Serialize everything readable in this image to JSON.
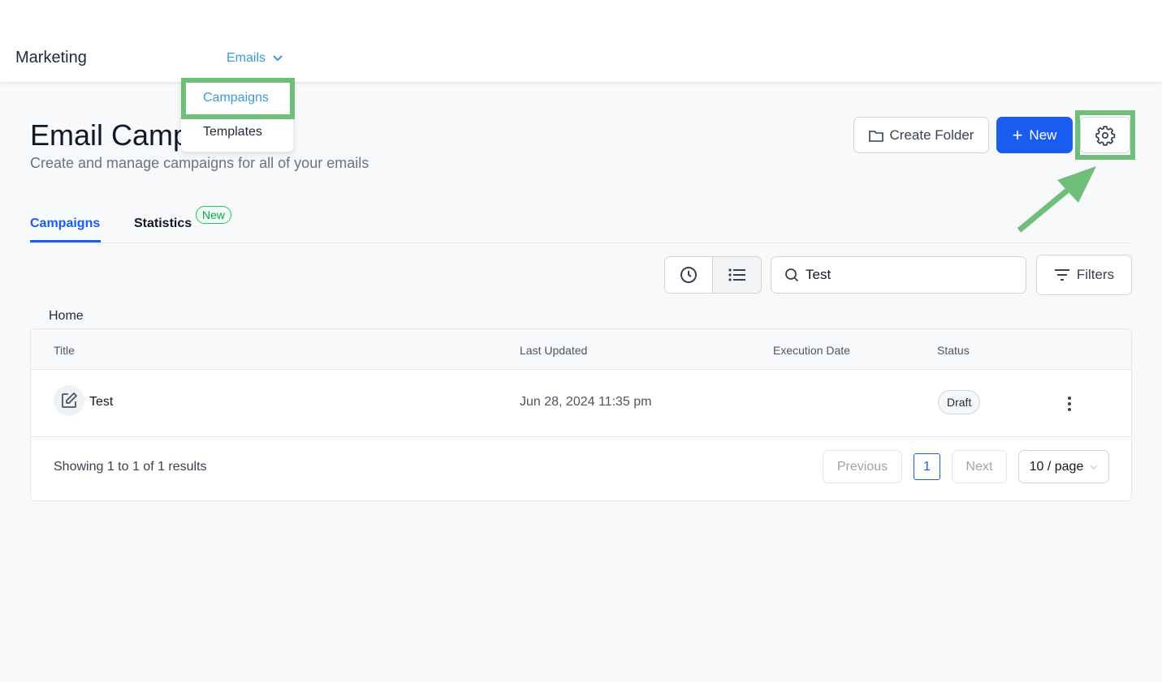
{
  "header": {
    "brand": "Marketing",
    "nav_label": "Emails",
    "menu": [
      {
        "label": "Campaigns"
      },
      {
        "label": "Templates"
      }
    ]
  },
  "page": {
    "title": "Email Campaigns",
    "subtitle": "Create and manage campaigns for all of your emails"
  },
  "actions": {
    "create_folder": "Create Folder",
    "new": "New"
  },
  "tabs": [
    {
      "label": "Campaigns",
      "active": true
    },
    {
      "label": "Statistics",
      "badge": "New"
    }
  ],
  "search": {
    "value": "Test",
    "placeholder": "Search"
  },
  "filters_label": "Filters",
  "breadcrumb": "Home",
  "table": {
    "columns": [
      "Title",
      "Last Updated",
      "Execution Date",
      "Status"
    ],
    "rows": [
      {
        "title": "Test",
        "last_updated": "Jun 28, 2024 11:35 pm",
        "execution_date": "",
        "status": "Draft"
      }
    ]
  },
  "pagination": {
    "summary": "Showing 1 to 1 of 1 results",
    "previous": "Previous",
    "current": "1",
    "next": "Next",
    "page_size": "10 / page"
  },
  "colors": {
    "accent": "#1a5cf0",
    "highlight": "#6fbf7a",
    "link": "#3b9ad9"
  }
}
